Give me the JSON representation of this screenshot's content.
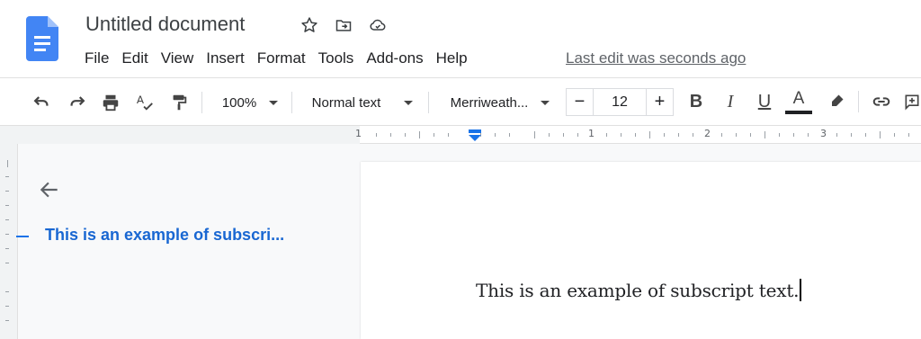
{
  "header": {
    "title": "Untitled document",
    "menu": [
      "File",
      "Edit",
      "View",
      "Insert",
      "Format",
      "Tools",
      "Add-ons",
      "Help"
    ],
    "last_edit": "Last edit was seconds ago",
    "icons": [
      "star-icon",
      "move-to-folder-icon",
      "cloud-status-icon"
    ]
  },
  "toolbar": {
    "zoom": "100%",
    "style": "Normal text",
    "font": "Merriweath...",
    "font_size": "12",
    "minus": "−",
    "plus": "+",
    "bold": "B",
    "italic": "I",
    "underline": "U",
    "text_color_letter": "A",
    "text_color": "#202124"
  },
  "ruler": {
    "numbers": [
      "1",
      "1",
      "2",
      "3"
    ]
  },
  "outline": {
    "items": [
      {
        "label": "This is an example of subscri..."
      }
    ]
  },
  "document": {
    "text": "This is an example of subscript text."
  },
  "colors": {
    "accent": "#1a73e8",
    "outline_text": "#1967d2",
    "docs_blue": "#4285f4"
  }
}
